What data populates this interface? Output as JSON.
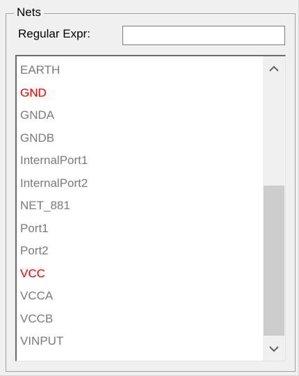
{
  "group": {
    "title": "Nets"
  },
  "filter": {
    "label": "Regular Expr:",
    "value": "",
    "placeholder": ""
  },
  "nets": [
    {
      "name": "EARTH",
      "highlighted": false
    },
    {
      "name": "GND",
      "highlighted": true
    },
    {
      "name": "GNDA",
      "highlighted": false
    },
    {
      "name": "GNDB",
      "highlighted": false
    },
    {
      "name": "InternalPort1",
      "highlighted": false
    },
    {
      "name": "InternalPort2",
      "highlighted": false
    },
    {
      "name": "NET_881",
      "highlighted": false
    },
    {
      "name": "Port1",
      "highlighted": false
    },
    {
      "name": "Port2",
      "highlighted": false
    },
    {
      "name": "VCC",
      "highlighted": true
    },
    {
      "name": "VCCA",
      "highlighted": false
    },
    {
      "name": "VCCB",
      "highlighted": false
    },
    {
      "name": "VINPUT",
      "highlighted": false
    }
  ],
  "colors": {
    "highlighted": "#ff0000",
    "normal": "#7a7a7a"
  },
  "icons": {
    "scroll_up": "chevron-up-icon",
    "scroll_down": "chevron-down-icon"
  }
}
